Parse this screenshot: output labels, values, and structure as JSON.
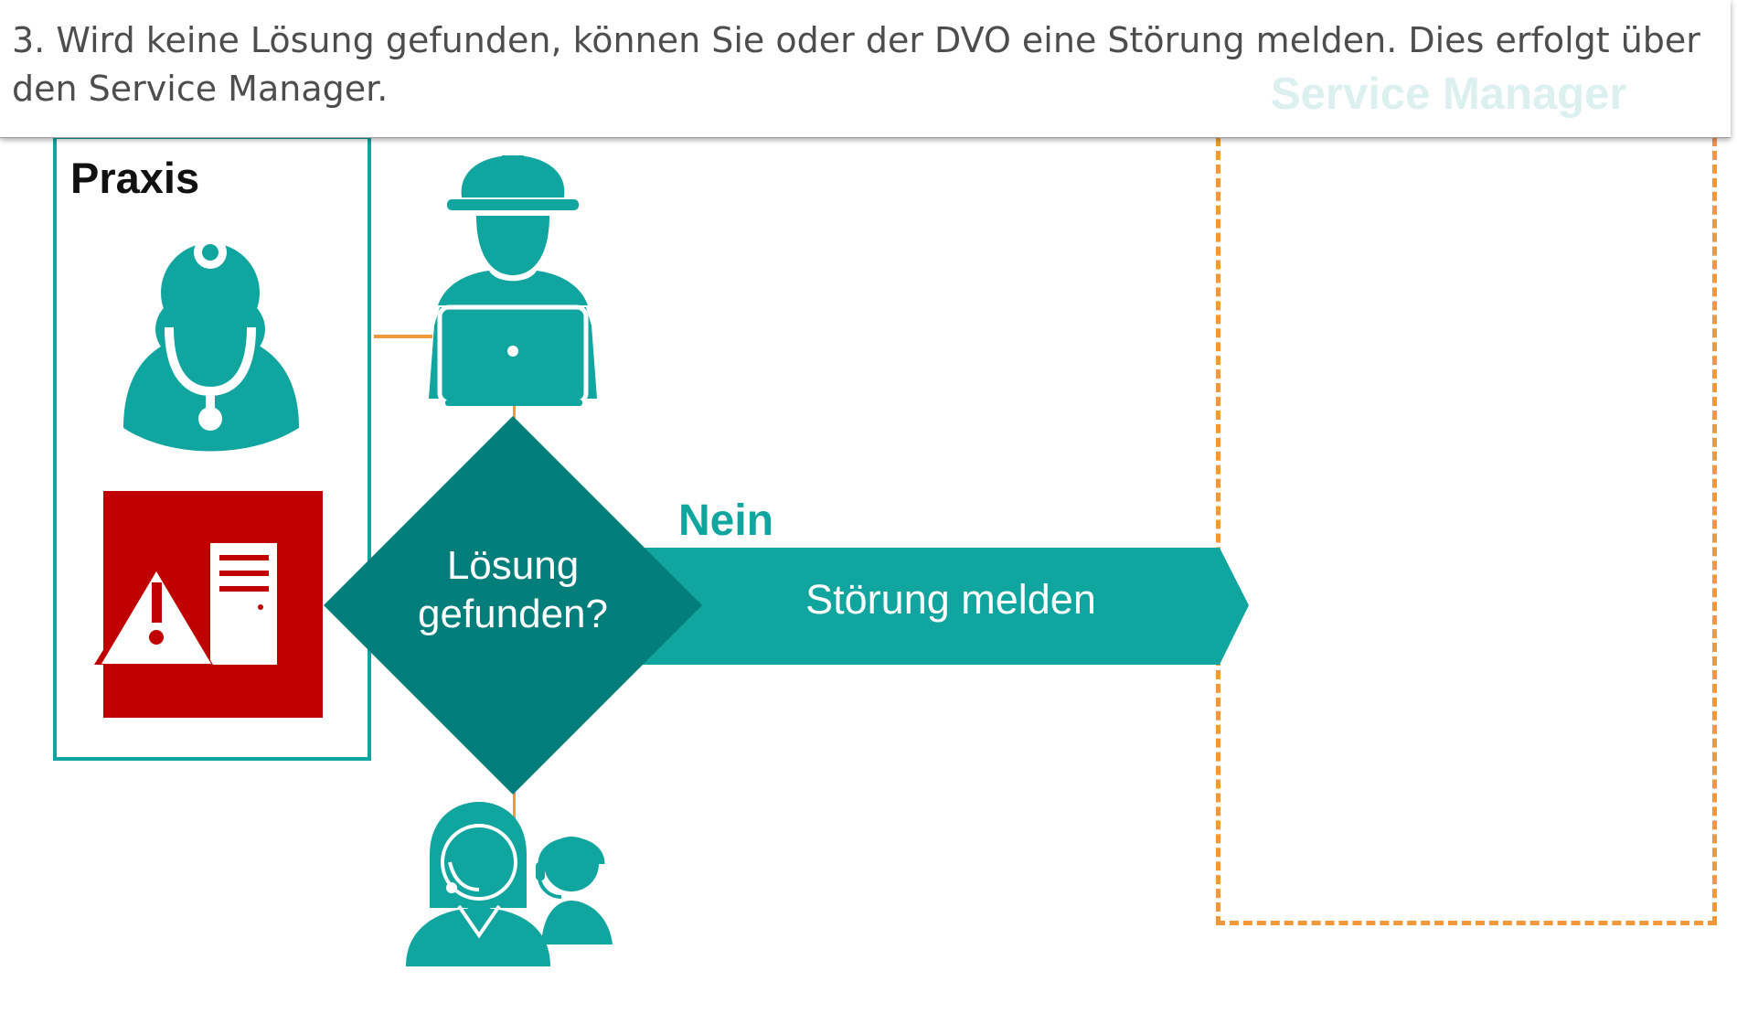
{
  "caption": {
    "text": "3. Wird keine Lösung gefunden, können Sie oder der DVO eine Störung melden. Dies erfolgt über den Service Manager.",
    "ghost_title": "Service Manager"
  },
  "praxis": {
    "label": "Praxis"
  },
  "decision": {
    "label": "Lösung gefunden?"
  },
  "branch": {
    "label": "Nein"
  },
  "action": {
    "label": "Störung melden"
  },
  "icons": [
    "doctor-icon",
    "error-server-icon",
    "technician-laptop-icon",
    "support-agents-icon"
  ],
  "colors": {
    "teal": "#11a59f",
    "dark_teal": "#047e7a",
    "alert_red": "#c00000",
    "orange": "#f0983a"
  }
}
